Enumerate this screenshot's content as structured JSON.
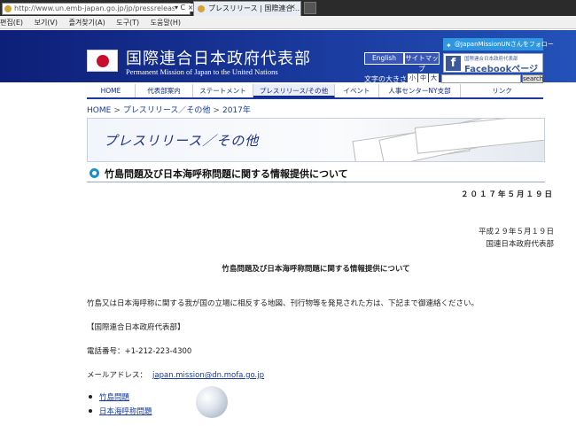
{
  "browser": {
    "address": "http://www.un.emb-japan.go.jp/jp/pressreleases/0519",
    "address_buttons": "▾ C ×",
    "tab_title": "プレスリリース | 国際連合...",
    "tab_close": "×",
    "menu": [
      "편집(E)",
      "보기(V)",
      "즐겨찾기(A)",
      "도구(T)",
      "도움말(H)"
    ]
  },
  "header": {
    "title": "国際連合日本政府代表部",
    "subtitle": "Permanent Mission of Japan to the United Nations",
    "english_button": "English",
    "sitemap_button": "サイトマップ",
    "twitter": "@JapanMissionUNさんをフォロー",
    "facebook_small": "国際連合日本政府代表部",
    "facebook_big": "Facebookページ",
    "fontsize_label": "文字の大きさ",
    "fontsize_buttons": [
      "小",
      "中",
      "大"
    ],
    "search_button": "search"
  },
  "nav": [
    {
      "label": "HOME",
      "active": false
    },
    {
      "label": "代表部案内",
      "active": false
    },
    {
      "label": "ステートメント",
      "active": false
    },
    {
      "label": "プレスリリース/その他",
      "active": true
    },
    {
      "label": "イベント",
      "active": false
    },
    {
      "label": "人事センターNY支部",
      "active": false
    },
    {
      "label": "リンク",
      "active": false
    }
  ],
  "breadcrumb": {
    "home": "HOME",
    "section": "プレスリリース／その他",
    "year": "2017年",
    "separator": ">"
  },
  "banner_title": "プレスリリース／その他",
  "page_heading": "竹島問題及び日本海呼称問題に関する情報提供について",
  "date": "２０１７年５月１９日",
  "doc": {
    "date": "平成２９年５月１９日",
    "org": "国連日本政府代表部",
    "title": "竹島問題及び日本海呼称問題に関する情報提供について",
    "body": "竹島又は日本海呼称に関する我が国の立場に相反する地図、刊行物等を発見された方は、下記まで御連絡ください。",
    "contact_org": "【国際連合日本政府代表部】",
    "phone": "電話番号：+1-212-223-4300",
    "mail_label": "メールアドレス：",
    "mail": "japan.mission@dn.mofa.go.jp"
  },
  "links": [
    "竹島問題",
    "日本海呼称問題"
  ]
}
